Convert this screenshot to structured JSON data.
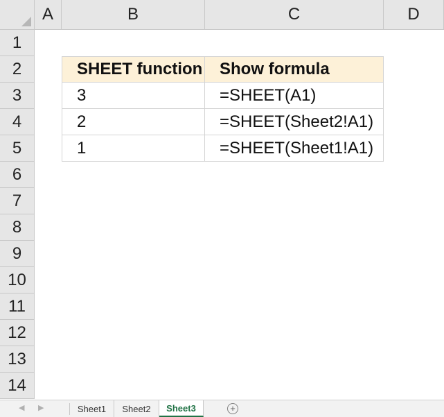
{
  "columns": [
    "A",
    "B",
    "C",
    "D"
  ],
  "rows": [
    "1",
    "2",
    "3",
    "4",
    "5",
    "6",
    "7",
    "8",
    "9",
    "10",
    "11",
    "12",
    "13",
    "14"
  ],
  "table": {
    "headers": [
      "SHEET function",
      "Show formula"
    ],
    "rows": [
      [
        "3",
        "=SHEET(A1)"
      ],
      [
        "2",
        "=SHEET(Sheet2!A1)"
      ],
      [
        "1",
        "=SHEET(Sheet1!A1)"
      ]
    ]
  },
  "sheet_tabs": [
    {
      "label": "Sheet1",
      "active": false
    },
    {
      "label": "Sheet2",
      "active": false
    },
    {
      "label": "Sheet3",
      "active": true
    }
  ],
  "colors": {
    "accent": "#217346",
    "header_fill": "#fdf1d8"
  },
  "icons": {
    "nav_prev": "caret-left-icon",
    "nav_next": "caret-right-icon",
    "add_sheet": "plus-circle-icon"
  }
}
